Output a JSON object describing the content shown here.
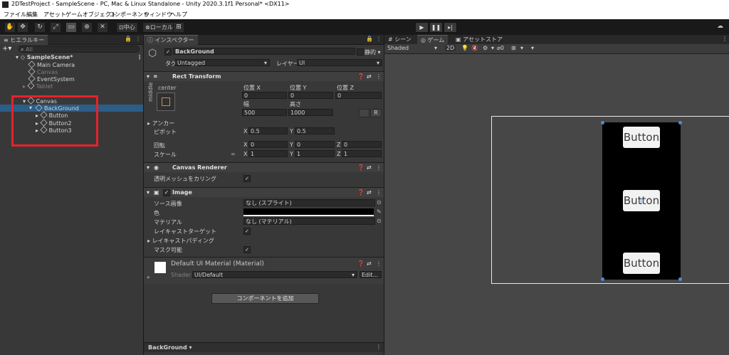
{
  "window": {
    "title": "2DTestProject - SampleScene - PC, Mac & Linux Standalone - Unity 2020.3.1f1 Personal* <DX11>"
  },
  "menu": [
    "ファイル",
    "編集",
    "アセット",
    "ゲームオブジェクト",
    "コンポーネント",
    "ウィンドウ",
    "ヘルプ"
  ],
  "toolbar": {
    "pivot_label": "中心",
    "space_label": "ローカル"
  },
  "hierarchy": {
    "tab": "ヒエラルキー",
    "search_placeholder": "All",
    "scene": "SampleScene*",
    "items": [
      {
        "label": "Main Camera"
      },
      {
        "label": "Canvas"
      },
      {
        "label": "EventSystem"
      },
      {
        "label": "Tablet"
      },
      {
        "label": "Canvas"
      },
      {
        "label": "BackGround"
      },
      {
        "label": "Button"
      },
      {
        "label": "Button2"
      },
      {
        "label": "Button3"
      }
    ]
  },
  "inspector": {
    "tab": "インスペクター",
    "object_name": "BackGround",
    "static_label": "静的",
    "tag_label": "タグ",
    "tag_value": "Untagged",
    "layer_label": "レイヤー",
    "layer_value": "UI",
    "rect_transform": {
      "header": "Rect Transform",
      "anchor_h": "center",
      "anchor_v": "middle",
      "pos_x_label": "位置 X",
      "pos_y_label": "位置 Y",
      "pos_z_label": "位置 Z",
      "pos_x": "0",
      "pos_y": "0",
      "pos_z": "0",
      "width_label": "幅",
      "height_label": "高さ",
      "width": "500",
      "height": "1000",
      "r_btn": "R",
      "anchor_label": "アンカー",
      "pivot_label": "ピボット",
      "pivot_x": "0.5",
      "pivot_y": "0.5",
      "rotation_label": "回転",
      "rot_x": "0",
      "rot_y": "0",
      "rot_z": "0",
      "scale_label": "スケール",
      "scale_x": "1",
      "scale_y": "1",
      "scale_z": "1"
    },
    "canvas_renderer": {
      "header": "Canvas Renderer",
      "cull_label": "透明メッシュをカリング"
    },
    "image": {
      "header": "Image",
      "source_label": "ソース画像",
      "source_value": "なし (スプライト)",
      "color_label": "色",
      "material_label": "マテリアル",
      "material_value": "なし (マテリアル)",
      "raycast_target_label": "レイキャストターゲット",
      "raycast_padding_label": "レイキャストパディング",
      "maskable_label": "マスク可能"
    },
    "material": {
      "name": "Default UI Material (Material)",
      "shader_label": "Shader",
      "shader_value": "UI/Default",
      "edit_label": "Edit..."
    },
    "add_component": "コンポーネントを追加",
    "bottom_label": "BackGround"
  },
  "scene": {
    "tabs": [
      "シーン",
      "ゲーム",
      "アセットストア"
    ],
    "shading": "Shaded",
    "mode_2d": "2D",
    "fx_count": "0",
    "buttons": [
      "Button",
      "Button",
      "Button"
    ]
  },
  "colors": {
    "selection": "#2c5d87",
    "highlight_box": "#e8212c",
    "scene_bg": "#474747",
    "panel_bg": "#383838"
  }
}
